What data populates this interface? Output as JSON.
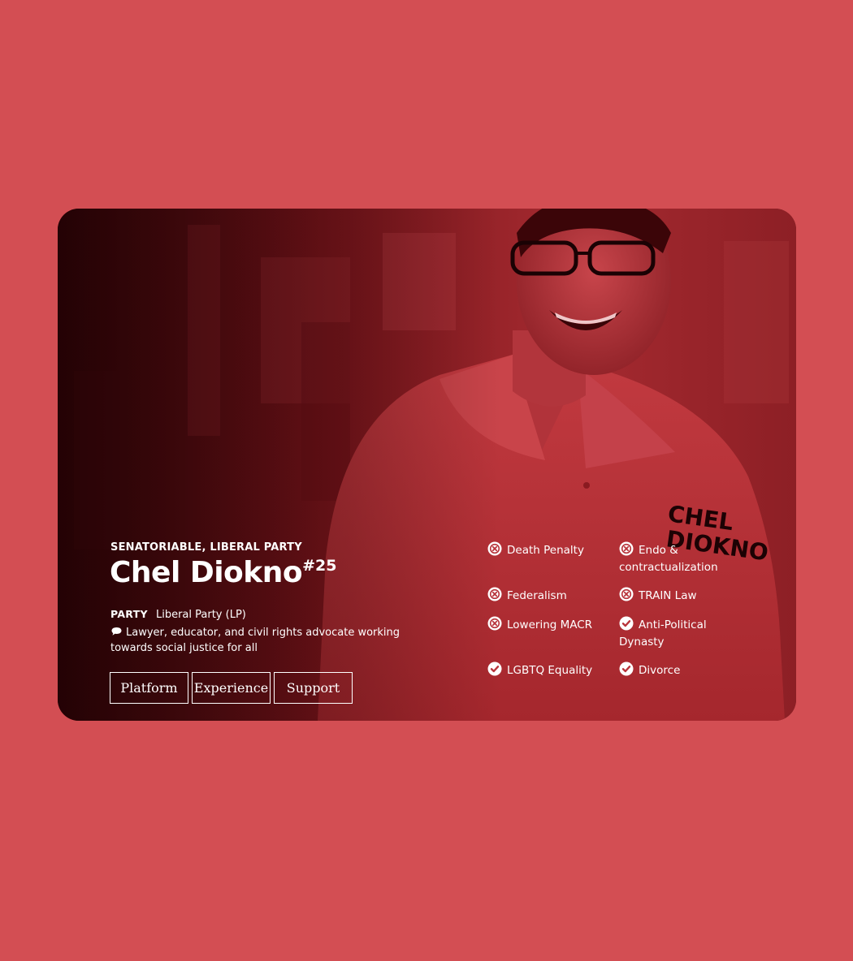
{
  "candidate": {
    "kicker": "SENATORIABLE, LIBERAL PARTY",
    "name": "Chel Diokno",
    "number": "#25",
    "party_label": "PARTY",
    "party_value": "Liberal Party (LP)",
    "description": "Lawyer, educator, and civil rights advocate working towards social justice for all",
    "shirt_text_line1": "CHEL",
    "shirt_text_line2": "DIOKNO"
  },
  "tabs": [
    {
      "label": "Platform"
    },
    {
      "label": "Experience"
    },
    {
      "label": "Support"
    }
  ],
  "stances": [
    {
      "label": "Death Penalty",
      "stance": "against",
      "icon": "x-circle-icon"
    },
    {
      "label": "Endo & contractualization",
      "stance": "against",
      "icon": "x-circle-icon"
    },
    {
      "label": "Federalism",
      "stance": "against",
      "icon": "x-circle-icon"
    },
    {
      "label": "TRAIN Law",
      "stance": "against",
      "icon": "x-circle-icon"
    },
    {
      "label": "Lowering MACR",
      "stance": "against",
      "icon": "x-circle-icon"
    },
    {
      "label": "Anti-Political Dynasty",
      "stance": "for",
      "icon": "check-circle-icon"
    },
    {
      "label": "LGBTQ Equality",
      "stance": "for",
      "icon": "check-circle-icon"
    },
    {
      "label": "Divorce",
      "stance": "for",
      "icon": "check-circle-icon"
    }
  ],
  "colors": {
    "page_background": "#d34e53",
    "photo_tint": "#c43a40",
    "text": "#ffffff"
  }
}
